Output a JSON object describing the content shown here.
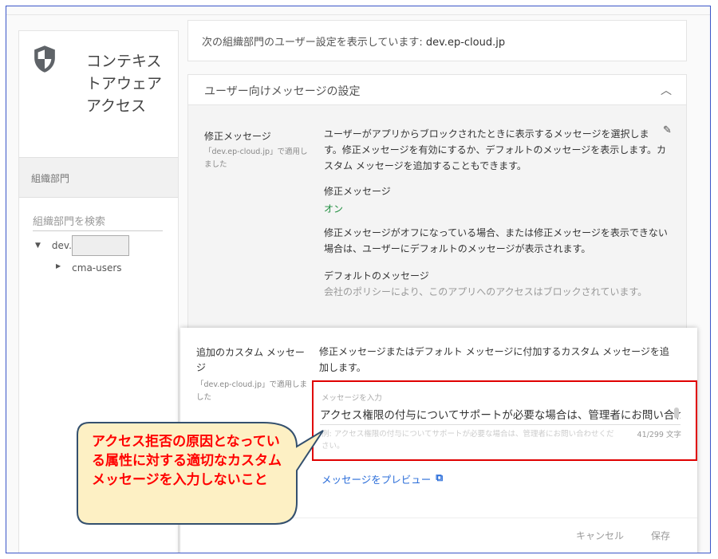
{
  "sidebar": {
    "app_title": "コンテキストアウェア アクセス",
    "org_heading": "組織部門",
    "search_placeholder": "組織部門を検索",
    "tree": [
      {
        "label": "dev.",
        "expanded": true
      },
      {
        "label": "cma-users",
        "expanded": false
      }
    ]
  },
  "header": {
    "prefix": "次の組織部門のユーザー設定を表示しています:",
    "domain": "dev.ep-cloud.jp"
  },
  "section": {
    "title": "ユーザー向けメッセージの設定",
    "remediation": {
      "label": "修正メッセージ",
      "applied": "「dev.ep-cloud.jp」で適用しました",
      "description": "ユーザーがアプリからブロックされたときに表示するメッセージを選択します。修正メッセージを有効にするか、デフォルトのメッセージを表示します。カスタム メッセージを追加することもできます。",
      "status_label": "修正メッセージ",
      "status_value": "オン",
      "note": "修正メッセージがオフになっている場合、または修正メッセージを表示できない場合は、ユーザーにデフォルトのメッセージが表示されます。",
      "default_label": "デフォルトのメッセージ",
      "default_value": "会社のポリシーにより、このアプリへのアクセスはブロックされています。"
    }
  },
  "custom": {
    "label": "追加のカスタム メッセージ",
    "applied": "「dev.ep-cloud.jp」で適用しました",
    "description": "修正メッセージまたはデフォルト メッセージに付加するカスタム メッセージを追加します。",
    "input_label": "メッセージを入力",
    "input_value": "アクセス権限の付与についてサポートが必要な場合は、管理者にお問い合わせください。",
    "hint": "例: アクセス権限の付与についてサポートが必要な場合は、管理者にお問い合わせください。",
    "count": "41/299 文字",
    "preview": "メッセージをプレビュー",
    "cancel": "キャンセル",
    "save": "保存"
  },
  "callout": {
    "text": "アクセス拒否の原因となっている属性に対する適切なカスタムメッセージを入力しないこと"
  },
  "colors": {
    "accent": "#2a6dd9",
    "on": "#1e8e3e",
    "highlight": "#e00000",
    "callout_fill": "#fdf0c4"
  }
}
